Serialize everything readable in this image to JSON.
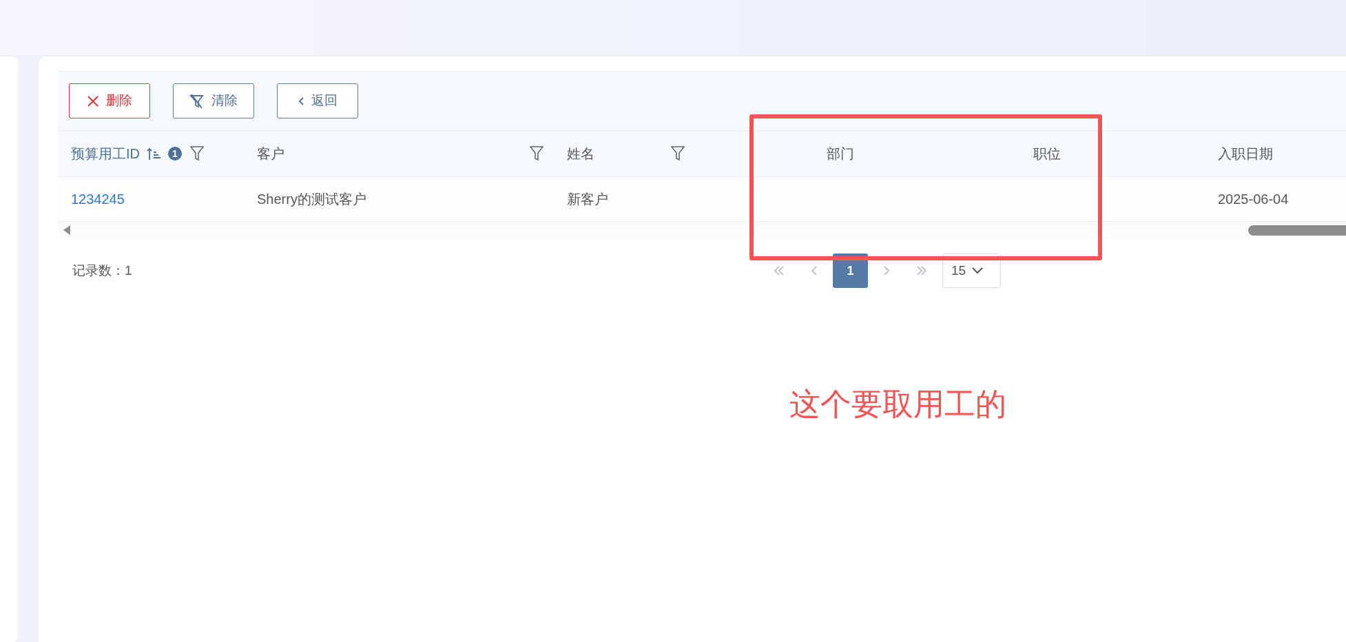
{
  "toolbar": {
    "buttons": [
      {
        "kind": "delete",
        "label": "删除"
      },
      {
        "kind": "clear_filter",
        "label": "清除"
      },
      {
        "kind": "back",
        "label": "返回"
      }
    ]
  },
  "table": {
    "columns": [
      {
        "label": "预算用工ID",
        "sort_ascending": true,
        "sort_order": "1",
        "filter": true
      },
      {
        "label": "客户",
        "filter": true
      },
      {
        "label": "姓名",
        "filter": true
      },
      {
        "label": "部门",
        "filter": false
      },
      {
        "label": "职位",
        "filter": false
      },
      {
        "label": "入职日期",
        "filter": false
      }
    ],
    "rows": [
      {
        "id": "1234245",
        "customer": "Sherry的测试客户",
        "name": "新客户",
        "hire_date": "2025-06-04"
      }
    ]
  },
  "record_count": "记录数：1",
  "pagination": {
    "pages": [
      {
        "label": "1",
        "selected": true
      }
    ],
    "page_size": "15"
  },
  "annotation": {
    "text": "这个要取用工的"
  }
}
